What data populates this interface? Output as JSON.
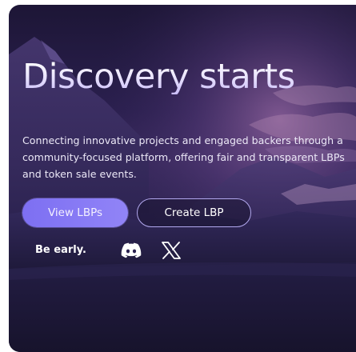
{
  "hero": {
    "headline": "Discovery starts",
    "description": "Connecting innovative projects and engaged backers through a community-focused platform, offering fair and transparent LBPs and token sale events.",
    "primary_button": "View LBPs",
    "secondary_button": "Create LBP",
    "tagline": "Be early."
  },
  "social": {
    "icons": [
      "discord-icon",
      "x-icon"
    ]
  },
  "colors": {
    "accent": "#8b7ef5",
    "background": "#241c45",
    "outline": "#b2a8ee",
    "text": "#ffffff"
  }
}
